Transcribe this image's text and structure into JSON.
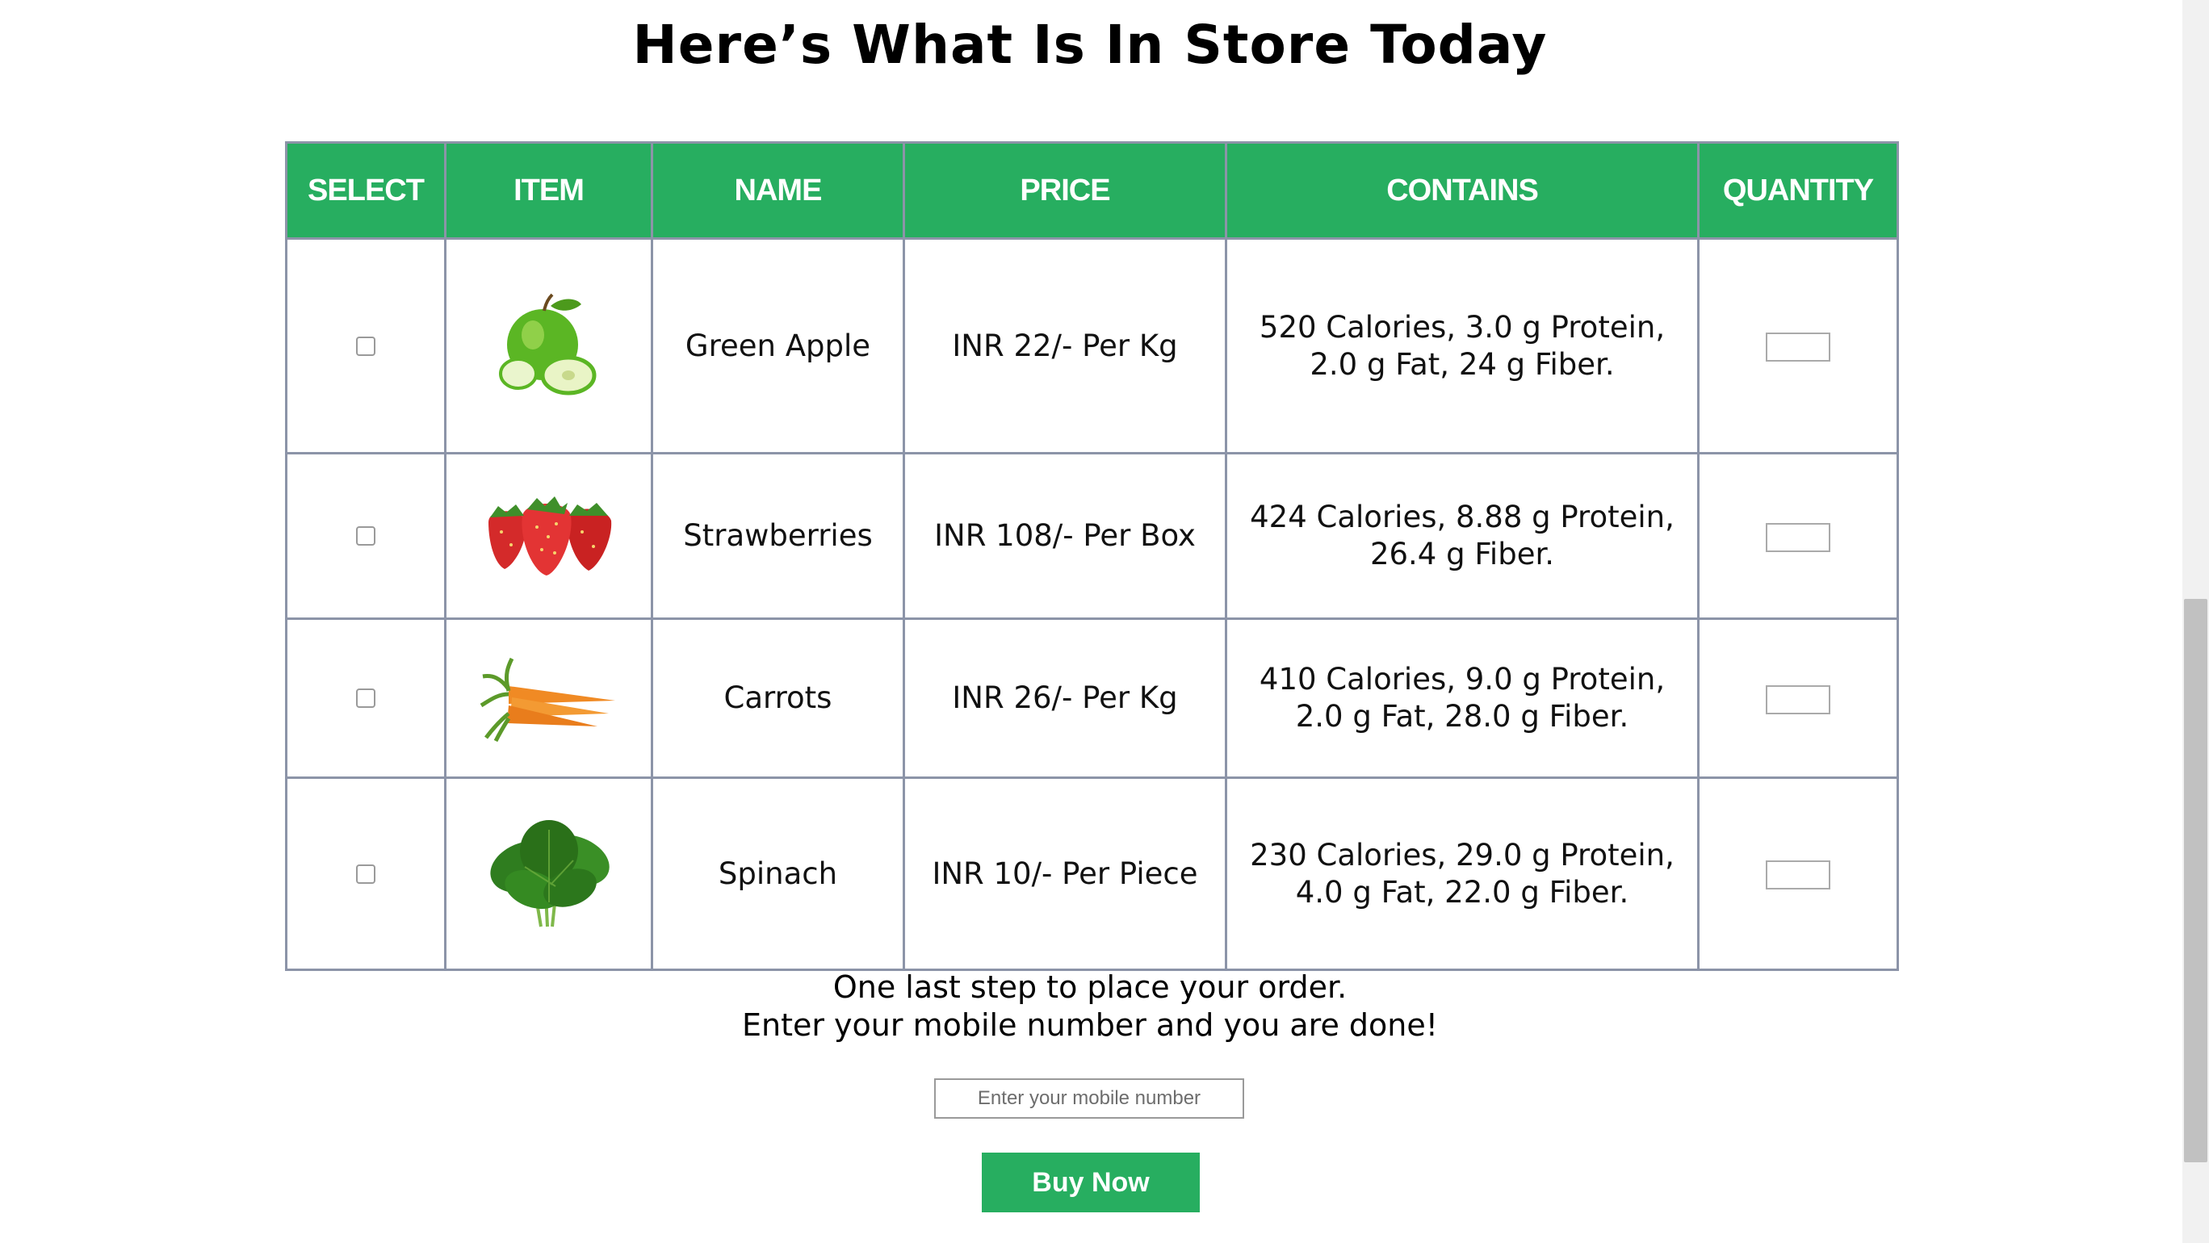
{
  "page": {
    "title": "Here’s What Is In Store Today"
  },
  "table": {
    "headers": [
      "SELECT",
      "ITEM",
      "NAME",
      "PRICE",
      "CONTAINS",
      "QUANTITY"
    ],
    "rows": [
      {
        "icon": "green-apple-image",
        "name": "Green Apple",
        "price": "INR 22/- Per Kg",
        "contains_line1": "520 Calories, 3.0 g Protein,",
        "contains_line2": "2.0 g Fat, 24 g Fiber.",
        "quantity": ""
      },
      {
        "icon": "strawberries-image",
        "name": "Strawberries",
        "price": "INR 108/- Per Box",
        "contains_line1": "424 Calories, 8.88 g Protein,",
        "contains_line2": "26.4 g Fiber.",
        "quantity": ""
      },
      {
        "icon": "carrots-image",
        "name": "Carrots",
        "price": "INR 26/- Per Kg",
        "contains_line1": "410 Calories, 9.0 g Protein,",
        "contains_line2": "2.0 g Fat, 28.0 g Fiber.",
        "quantity": ""
      },
      {
        "icon": "spinach-image",
        "name": "Spinach",
        "price": "INR 10/- Per Piece",
        "contains_line1": "230 Calories, 29.0 g Protein,",
        "contains_line2": "4.0 g Fat, 22.0 g Fiber.",
        "quantity": ""
      }
    ]
  },
  "order": {
    "line1": "One last step to place your order.",
    "line2": "Enter your mobile number and you are done!",
    "mobile_placeholder": "Enter your mobile number",
    "buy_label": "Buy Now"
  },
  "colors": {
    "accent": "#27ae60",
    "border": "#8c94a8"
  }
}
